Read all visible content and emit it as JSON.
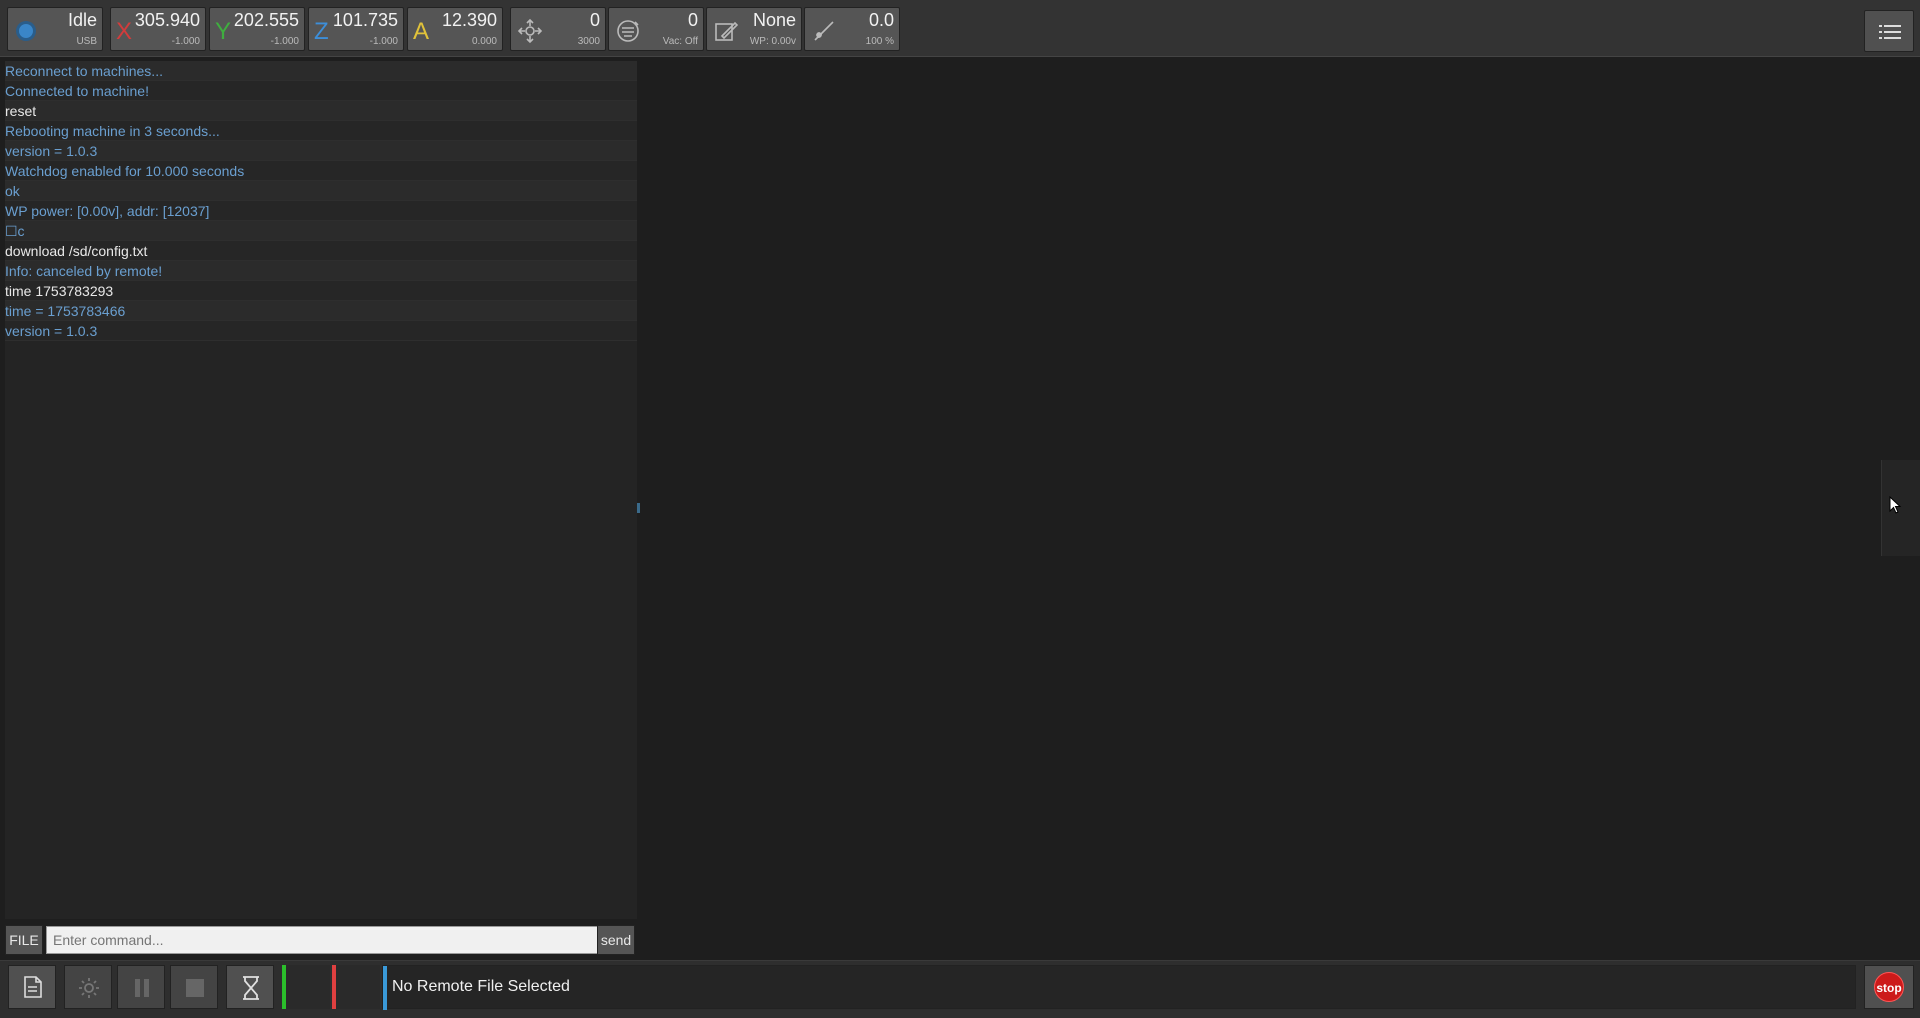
{
  "status": {
    "state": "Idle",
    "connection": "USB"
  },
  "axes": [
    {
      "name": "X",
      "value": "305.940",
      "sub": "-1.000",
      "color": "#d23c3c"
    },
    {
      "name": "Y",
      "value": "202.555",
      "sub": "-1.000",
      "color": "#3fae3f"
    },
    {
      "name": "Z",
      "value": "101.735",
      "sub": "-1.000",
      "color": "#3d8ed8"
    },
    {
      "name": "A",
      "value": "12.390",
      "sub": "0.000",
      "color": "#e0c23a"
    }
  ],
  "feed": {
    "value": "0",
    "sub": "3000"
  },
  "spindle": {
    "value": "0",
    "sub": "Vac: Off"
  },
  "tool": {
    "value": "None",
    "sub": "WP: 0.00v"
  },
  "laser": {
    "value": "0.0",
    "sub": "100 %"
  },
  "console": {
    "lines": [
      {
        "text": "Reconnect to machines...",
        "kind": "info"
      },
      {
        "text": "Connected to machine!",
        "kind": "info"
      },
      {
        "text": "reset",
        "kind": "cmd"
      },
      {
        "text": "Rebooting machine in 3 seconds...",
        "kind": "info"
      },
      {
        "text": "version = 1.0.3",
        "kind": "info"
      },
      {
        "text": "Watchdog enabled for 10.000 seconds",
        "kind": "info"
      },
      {
        "text": "ok",
        "kind": "info"
      },
      {
        "text": "WP power: [0.00v], addr: [12037]",
        "kind": "info"
      },
      {
        "text": "☐c",
        "kind": "info"
      },
      {
        "text": "download /sd/config.txt",
        "kind": "cmd"
      },
      {
        "text": "Info: canceled by remote!",
        "kind": "info"
      },
      {
        "text": "time 1753783293",
        "kind": "cmd"
      },
      {
        "text": "time = 1753783466",
        "kind": "info"
      },
      {
        "text": "version = 1.0.3",
        "kind": "info"
      }
    ]
  },
  "command": {
    "file_label": "FILE",
    "placeholder": "Enter command...",
    "send_label": "send"
  },
  "bottom": {
    "file_status": "No Remote File Selected",
    "stop_label": "stop"
  },
  "colors": {
    "accent": "#3a9ad9",
    "led_green": "#2bbf2b",
    "led_red": "#e04040",
    "stop": "#cc1a1a"
  },
  "icons": [
    "connection-indicator-icon",
    "move-icon",
    "spindle-icon",
    "tool-icon",
    "laser-icon",
    "menu-icon",
    "file-icon",
    "gear-icon",
    "pause-icon",
    "stop-square-icon",
    "hourglass-icon",
    "cursor-icon"
  ]
}
